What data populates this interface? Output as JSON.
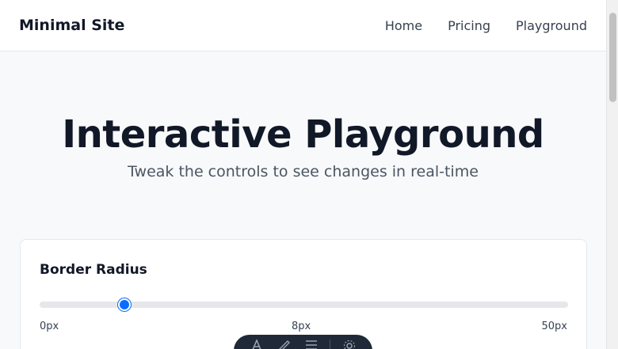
{
  "navbar": {
    "brand": "Minimal Site",
    "links": [
      {
        "label": "Home"
      },
      {
        "label": "Pricing"
      },
      {
        "label": "Playground"
      }
    ]
  },
  "hero": {
    "title": "Interactive Playground",
    "subtitle": "Tweak the controls to see changes in real-time"
  },
  "controls": {
    "border_radius": {
      "label": "Border Radius",
      "value": 8,
      "min": 0,
      "max": 50,
      "min_label": "0px",
      "value_label": "8px",
      "max_label": "50px"
    }
  },
  "toolbar": {
    "icons": [
      "text-icon",
      "draw-icon",
      "menu-icon",
      "settings-icon"
    ]
  },
  "colors": {
    "accent": "#0a6cff",
    "background": "#f8f9fa"
  }
}
